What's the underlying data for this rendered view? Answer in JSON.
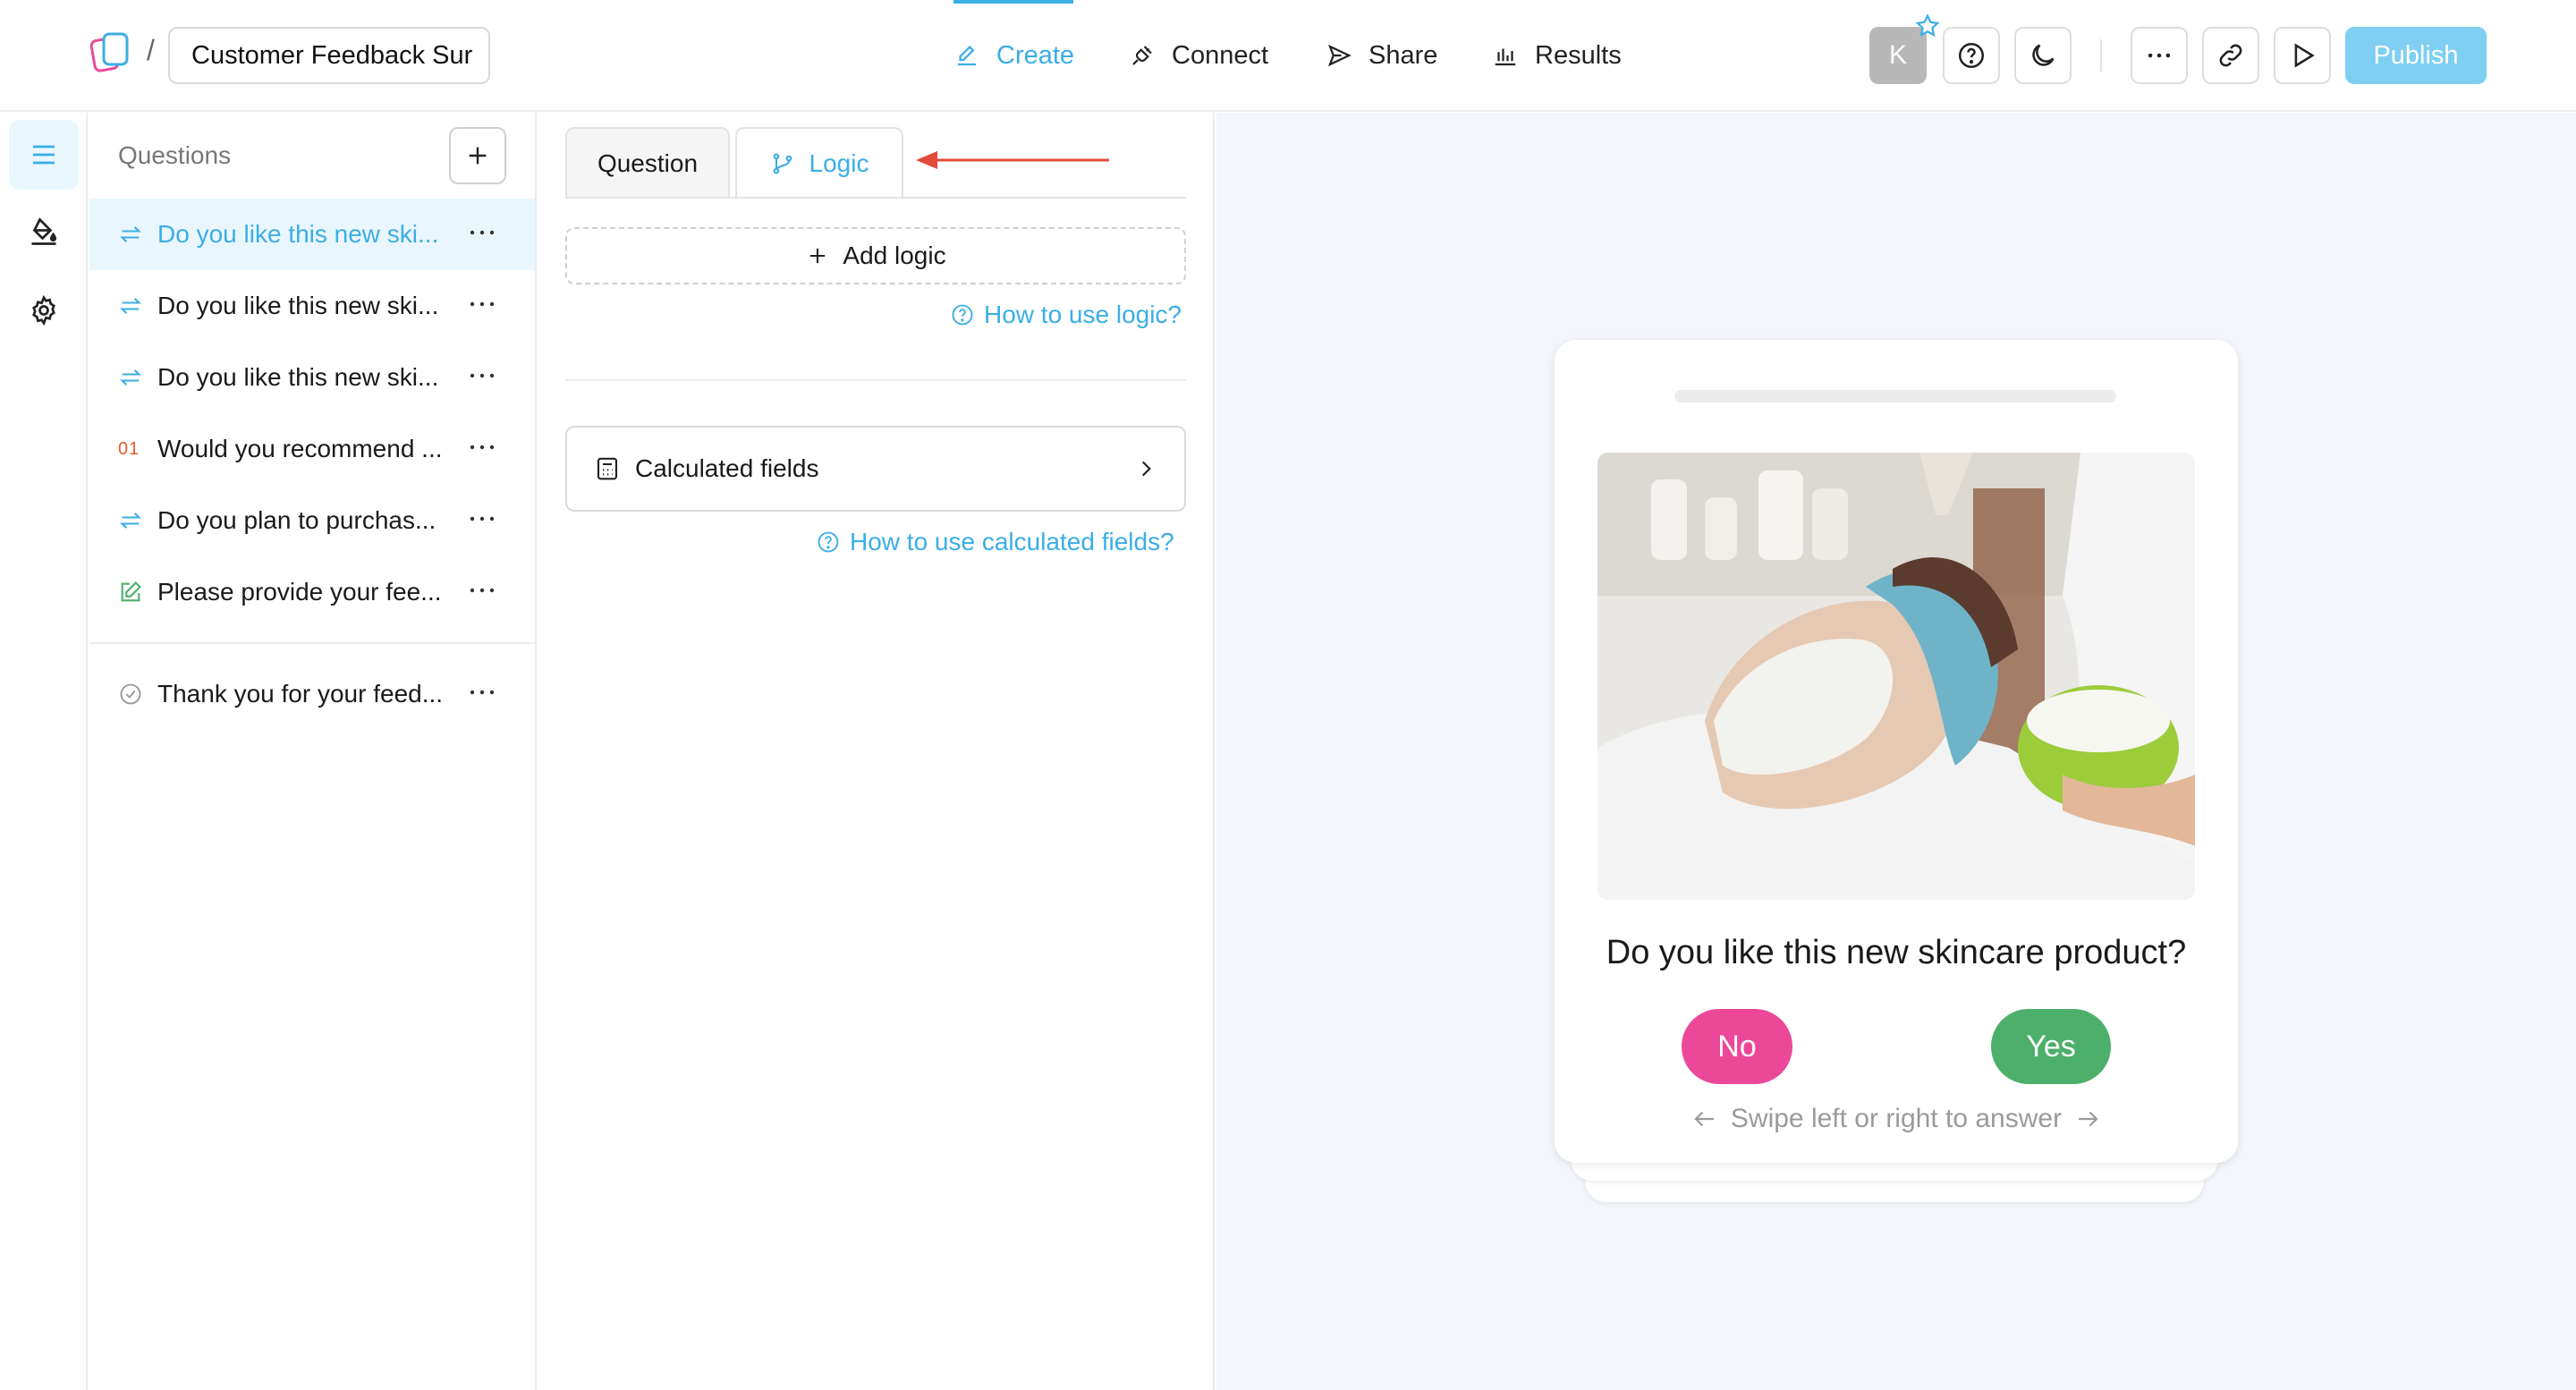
{
  "app": {
    "survey_title": "Customer Feedback Sur",
    "crumb_separator": "/",
    "nav": {
      "create": "Create",
      "connect": "Connect",
      "share": "Share",
      "results": "Results"
    },
    "avatar_initial": "K",
    "publish_label": "Publish",
    "accent_color": "#3aaee5"
  },
  "questions_panel": {
    "heading": "Questions",
    "items": [
      {
        "text": "Do you like this new ski...",
        "icon": "swap-icon",
        "active": true
      },
      {
        "text": "Do you like this new ski...",
        "icon": "swap-icon"
      },
      {
        "text": "Do you like this new ski...",
        "icon": "swap-icon"
      },
      {
        "text": "Would you recommend ...",
        "icon": "number-icon",
        "badge": "01"
      },
      {
        "text": "Do you plan to purchas...",
        "icon": "swap-icon"
      },
      {
        "text": "Please provide your fee...",
        "icon": "edit-icon"
      }
    ],
    "ending": {
      "text": "Thank you for your feed...",
      "icon": "check-circle-icon"
    }
  },
  "logic_panel": {
    "tab_question": "Question",
    "tab_logic": "Logic",
    "add_logic": "Add logic",
    "help_logic": "How to use logic?",
    "calculated_fields": "Calculated fields",
    "help_calculated": "How to use calculated fields?"
  },
  "preview": {
    "question": "Do you like this new skincare product?",
    "no_label": "No",
    "yes_label": "Yes",
    "swipe_hint": "Swipe left or right to answer",
    "no_color": "#ec4899",
    "yes_color": "#4caf6a"
  }
}
